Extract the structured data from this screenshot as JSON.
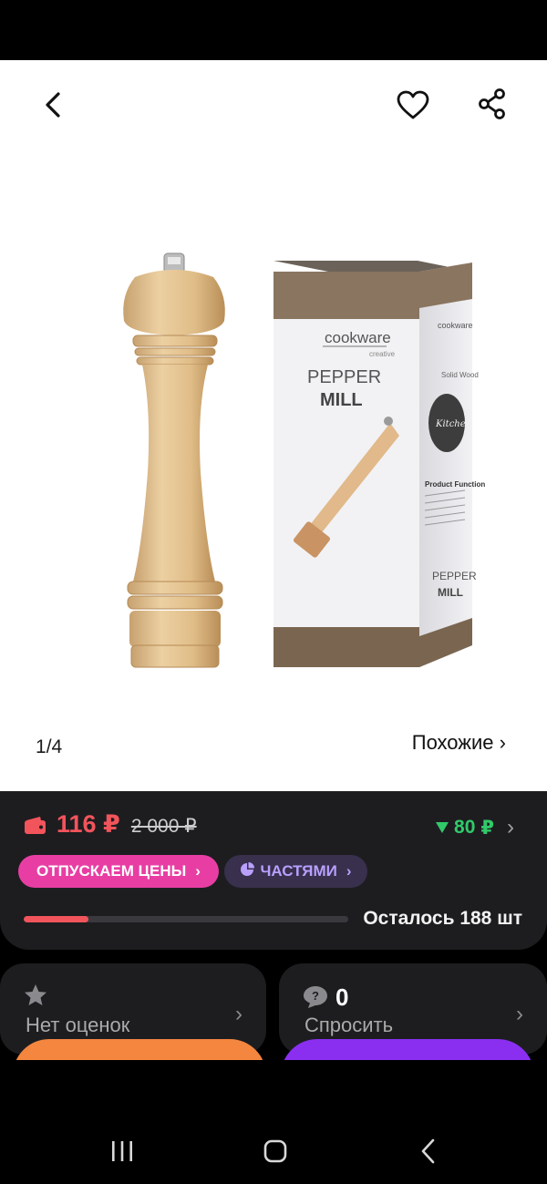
{
  "gallery": {
    "current_page": "1",
    "page_separator": "/",
    "total_pages": "4",
    "similar_label": "Похожие",
    "similar_chevron": "›",
    "icons": [
      "back-arrow-icon",
      "heart-icon",
      "share-icon"
    ]
  },
  "product_image": {
    "box_brand": "cookware",
    "box_brand_sub": "creative",
    "box_title_line1": "PEPPER",
    "box_title_line2": "MILL",
    "box_side_label1": "Solid Wood",
    "box_side_badge": "Kitchen",
    "box_side_heading": "Product Function",
    "box_side_title1": "PEPPER",
    "box_side_title2": "MILL"
  },
  "price": {
    "current": "116 ₽",
    "old": "2 000 ₽",
    "bonus_value": "80",
    "bonus_currency": "₽",
    "bonus_chevron": "›",
    "accent_color": "#f2545b",
    "bonus_color": "#31c96a"
  },
  "badges": {
    "sale_label": "ОТПУСКАЕМ ЦЕНЫ",
    "sale_chevron": "›",
    "parts_label": "ЧАСТЯМИ",
    "parts_chevron": "›"
  },
  "stock": {
    "label": "Осталось 188 шт",
    "fill_fraction": 0.2
  },
  "cards": {
    "rating_label": "Нет оценок",
    "rating_chevron": "›",
    "questions_count": "0",
    "questions_label": "Спросить",
    "questions_chevron": "›"
  },
  "system_nav": {
    "icons": [
      "recents-icon",
      "home-icon",
      "back-icon"
    ]
  }
}
